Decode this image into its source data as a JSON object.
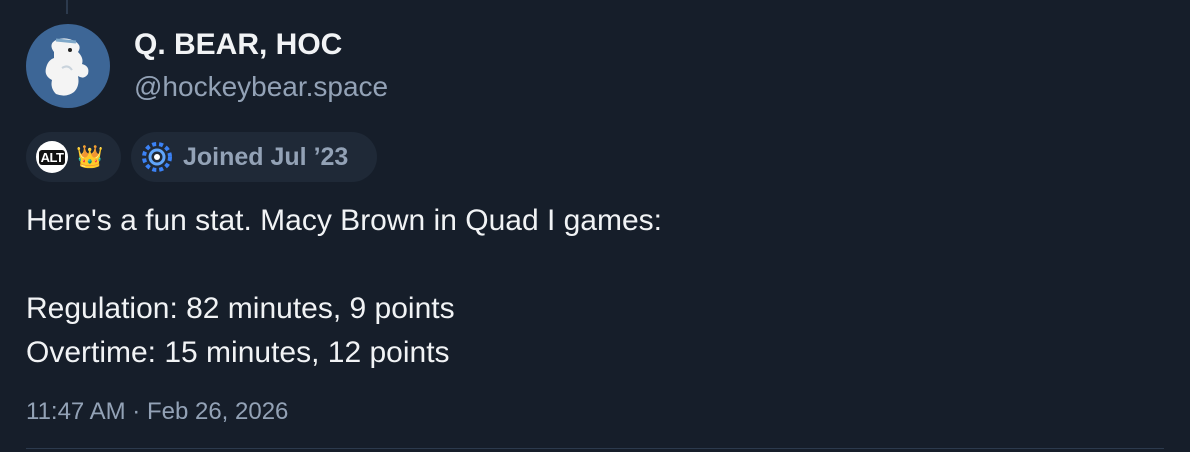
{
  "profile": {
    "display_name": "Q. BEAR, HOC",
    "handle": "@hockeybear.space",
    "avatar_icon": "polar-bear-icon"
  },
  "badges": {
    "labels": [
      "ALT",
      "👑"
    ],
    "joined": "Joined Jul ’23"
  },
  "post": {
    "lines": [
      "Here's a fun stat. Macy Brown in Quad I games:",
      "",
      "Regulation: 82 minutes, 9 points",
      "Overtime: 15 minutes, 12 points"
    ],
    "timestamp": "11:47 AM · Feb 26, 2026"
  },
  "colors": {
    "background": "#161e2a",
    "text": "#f1f3f5",
    "muted": "#93a2b6",
    "avatar_bg": "#3d6696",
    "pill_bg": "#1f2937",
    "divider": "#2c3a4d"
  }
}
